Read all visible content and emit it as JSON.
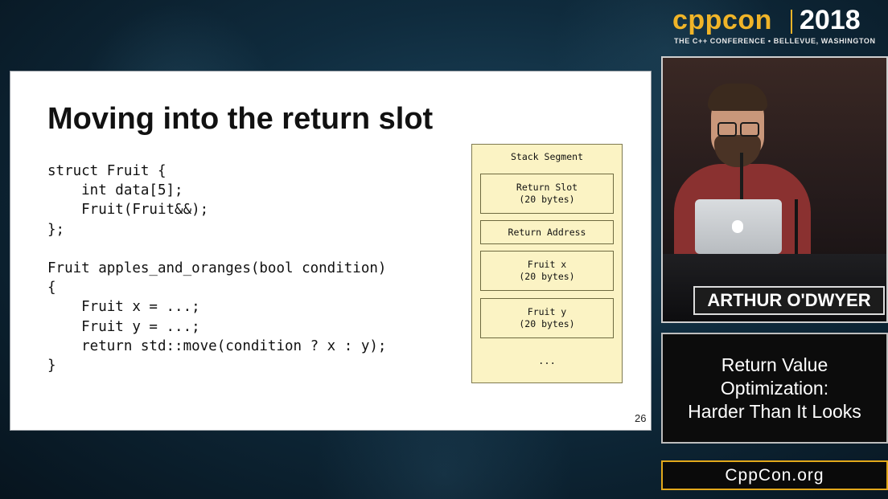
{
  "brand": {
    "logo_cpp": "cpp",
    "logo_con": "con",
    "year": "2018",
    "tagline": "THE C++ CONFERENCE • BELLEVUE, WASHINGTON"
  },
  "slide": {
    "title": "Moving into the return slot",
    "code": "struct Fruit {\n    int data[5];\n    Fruit(Fruit&&);\n};\n\nFruit apples_and_oranges(bool condition)\n{\n    Fruit x = ...;\n    Fruit y = ...;\n    return std::move(condition ? x : y);\n}",
    "page_number": "26",
    "stack": {
      "title": "Stack Segment",
      "frames": [
        {
          "line1": "Return Slot",
          "line2": "(20 bytes)"
        },
        {
          "line1": "Return Address",
          "line2": ""
        },
        {
          "line1": "Fruit x",
          "line2": "(20 bytes)"
        },
        {
          "line1": "Fruit y",
          "line2": "(20 bytes)"
        }
      ],
      "ellipsis": "..."
    }
  },
  "speaker": {
    "name": "ARTHUR O'DWYER"
  },
  "talk": {
    "line1": "Return Value",
    "line2": "Optimization:",
    "line3": "Harder Than It Looks"
  },
  "footer": {
    "url": "CppCon.org"
  }
}
